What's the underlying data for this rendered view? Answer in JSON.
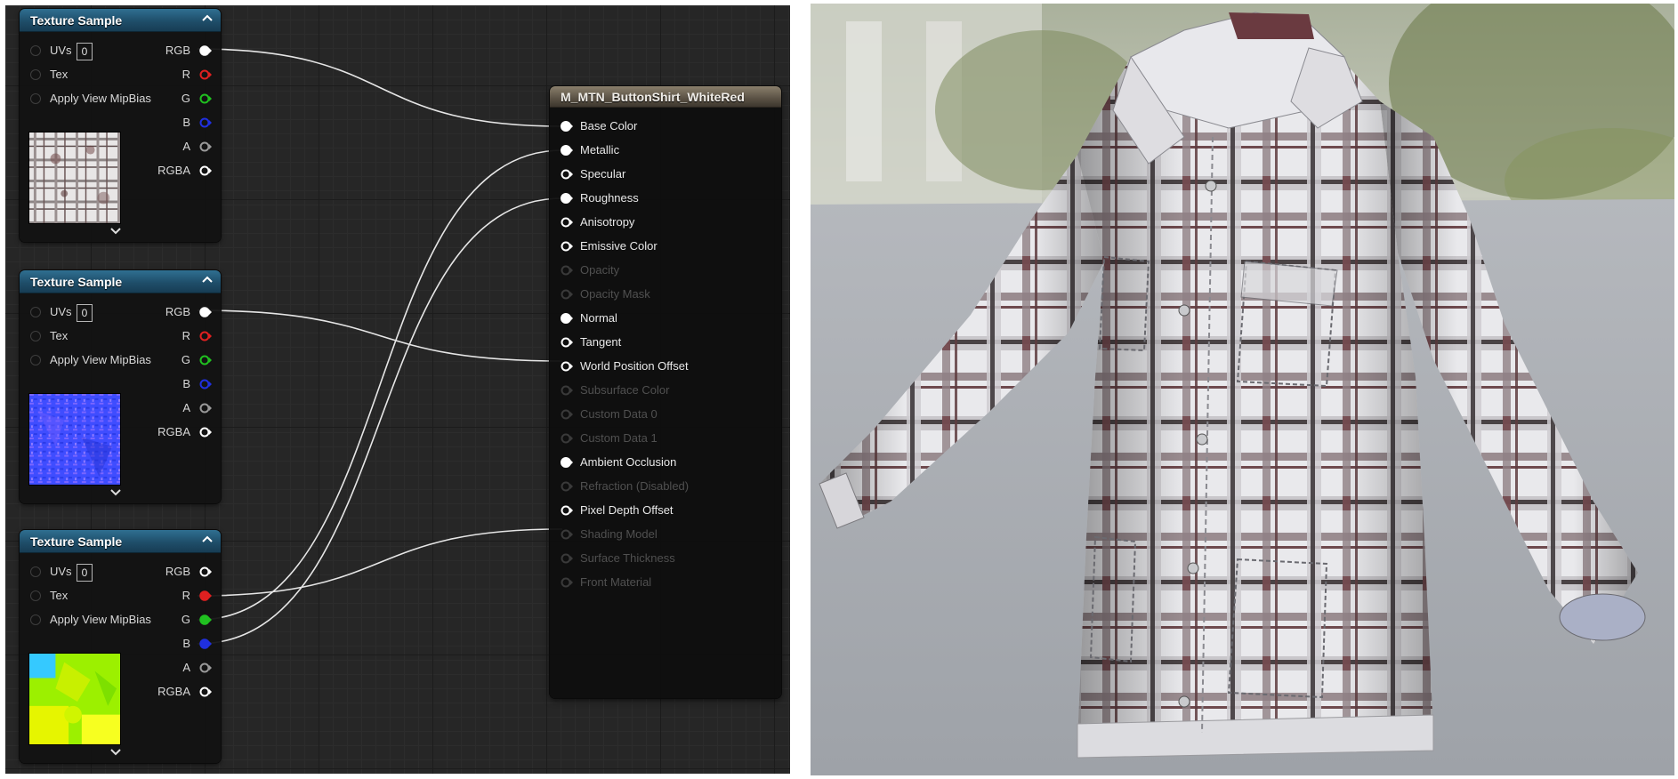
{
  "texture_nodes": [
    {
      "title": "Texture Sample",
      "inputs": {
        "uvs": "UVs",
        "uv_value": "0",
        "tex": "Tex",
        "mip": "Apply View MipBias"
      },
      "outputs": {
        "rgb": "RGB",
        "r": "R",
        "g": "G",
        "b": "B",
        "a": "A",
        "rgba": "RGBA"
      },
      "thumbnail": "base-color-plaid-texture"
    },
    {
      "title": "Texture Sample",
      "inputs": {
        "uvs": "UVs",
        "uv_value": "0",
        "tex": "Tex",
        "mip": "Apply View MipBias"
      },
      "outputs": {
        "rgb": "RGB",
        "r": "R",
        "g": "G",
        "b": "B",
        "a": "A",
        "rgba": "RGBA"
      },
      "thumbnail": "normal-map-texture"
    },
    {
      "title": "Texture Sample",
      "inputs": {
        "uvs": "UVs",
        "uv_value": "0",
        "tex": "Tex",
        "mip": "Apply View MipBias"
      },
      "outputs": {
        "rgb": "RGB",
        "r": "R",
        "g": "G",
        "b": "B",
        "a": "A",
        "rgba": "RGBA"
      },
      "thumbnail": "orm-packed-texture"
    }
  ],
  "material_node": {
    "title": "M_MTN_ButtonShirt_WhiteRed",
    "pins": [
      {
        "label": "Base Color",
        "enabled": true,
        "connected": true
      },
      {
        "label": "Metallic",
        "enabled": true,
        "connected": true
      },
      {
        "label": "Specular",
        "enabled": true,
        "connected": false
      },
      {
        "label": "Roughness",
        "enabled": true,
        "connected": true
      },
      {
        "label": "Anisotropy",
        "enabled": true,
        "connected": false
      },
      {
        "label": "Emissive Color",
        "enabled": true,
        "connected": false
      },
      {
        "label": "Opacity",
        "enabled": false,
        "connected": false
      },
      {
        "label": "Opacity Mask",
        "enabled": false,
        "connected": false
      },
      {
        "label": "Normal",
        "enabled": true,
        "connected": true
      },
      {
        "label": "Tangent",
        "enabled": true,
        "connected": false
      },
      {
        "label": "World Position Offset",
        "enabled": true,
        "connected": false
      },
      {
        "label": "Subsurface Color",
        "enabled": false,
        "connected": false
      },
      {
        "label": "Custom Data 0",
        "enabled": false,
        "connected": false
      },
      {
        "label": "Custom Data 1",
        "enabled": false,
        "connected": false
      },
      {
        "label": "Ambient Occlusion",
        "enabled": true,
        "connected": true
      },
      {
        "label": "Refraction (Disabled)",
        "enabled": false,
        "connected": false
      },
      {
        "label": "Pixel Depth Offset",
        "enabled": true,
        "connected": false
      },
      {
        "label": "Shading Model",
        "enabled": false,
        "connected": false
      },
      {
        "label": "Surface Thickness",
        "enabled": false,
        "connected": false
      },
      {
        "label": "Front Material",
        "enabled": false,
        "connected": false
      }
    ]
  },
  "colors": {
    "red_pin": "#e02020",
    "green_pin": "#20c020",
    "blue_pin": "#2030e0",
    "wire": "#e6e6e6",
    "texture_header": "#1f4e6a",
    "material_header": "#5a5144"
  },
  "viewport": {
    "subject": "plaid-button-shirt-preview"
  }
}
